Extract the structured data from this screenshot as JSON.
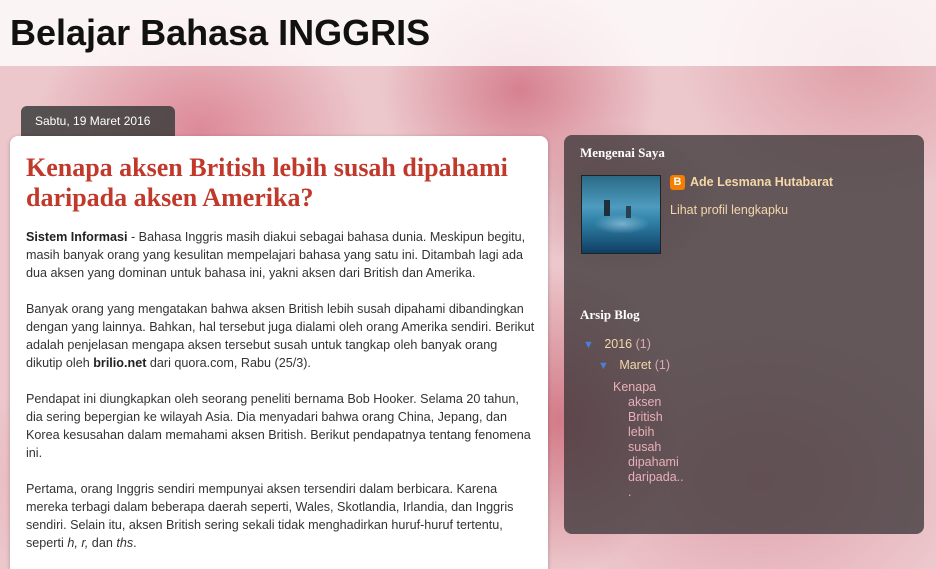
{
  "header": {
    "blog_title": "Belajar Bahasa INGGRIS"
  },
  "post": {
    "date": "Sabtu, 19 Maret 2016",
    "title": "Kenapa aksen British lebih susah dipahami daripada aksen Amerika?",
    "p1_bold": "Sistem Informasi",
    "p1_text": " - Bahasa Inggris masih diakui sebagai bahasa dunia. Meskipun begitu, masih banyak orang yang kesulitan mempelajari bahasa yang satu ini. Ditambah lagi ada dua aksen yang dominan untuk bahasa ini, yakni aksen dari British dan Amerika.",
    "p2_text": "Banyak orang yang mengatakan bahwa aksen British lebih susah dipahami dibandingkan dengan yang lainnya. Bahkan, hal tersebut juga dialami oleh orang Amerika sendiri. Berikut adalah penjelasan mengapa aksen tersebut susah untuk tangkap oleh banyak orang dikutip oleh ",
    "p2_bold": "brilio.net",
    "p2_tail": " dari quora.com, Rabu (25/3).",
    "p3_text": "Pendapat ini diungkapkan oleh seorang peneliti bernama Bob Hooker. Selama 20 tahun, dia sering bepergian ke wilayah Asia. Dia menyadari bahwa orang China, Jepang, dan Korea kesusahan dalam memahami aksen British. Berikut pendapatnya tentang fenomena ini.",
    "p4_text": "Pertama, orang Inggris sendiri mempunyai aksen tersendiri dalam berbicara. Karena mereka terbagi dalam beberapa daerah seperti, Wales, Skotlandia, Irlandia, dan Inggris sendiri. Selain itu, aksen British sering sekali tidak menghadirkan huruf-huruf tertentu, seperti ",
    "p4_i1": "h, r,",
    "p4_mid": " dan ",
    "p4_i2": "ths",
    "p4_tail": "."
  },
  "sidebar": {
    "about": {
      "title": "Mengenai Saya",
      "author": "Ade Lesmana Hutabarat",
      "profile_link": "Lihat profil lengkapku",
      "blogger_icon_letter": "B"
    },
    "archive": {
      "title": "Arsip Blog",
      "year": "2016",
      "year_count": "(1)",
      "month": "Maret",
      "month_count": "(1)",
      "post_lines": [
        "Kenapa",
        "aksen",
        "British",
        "lebih",
        "susah",
        "dipahami",
        "daripada..",
        "."
      ],
      "expand_icon": "▼"
    }
  }
}
